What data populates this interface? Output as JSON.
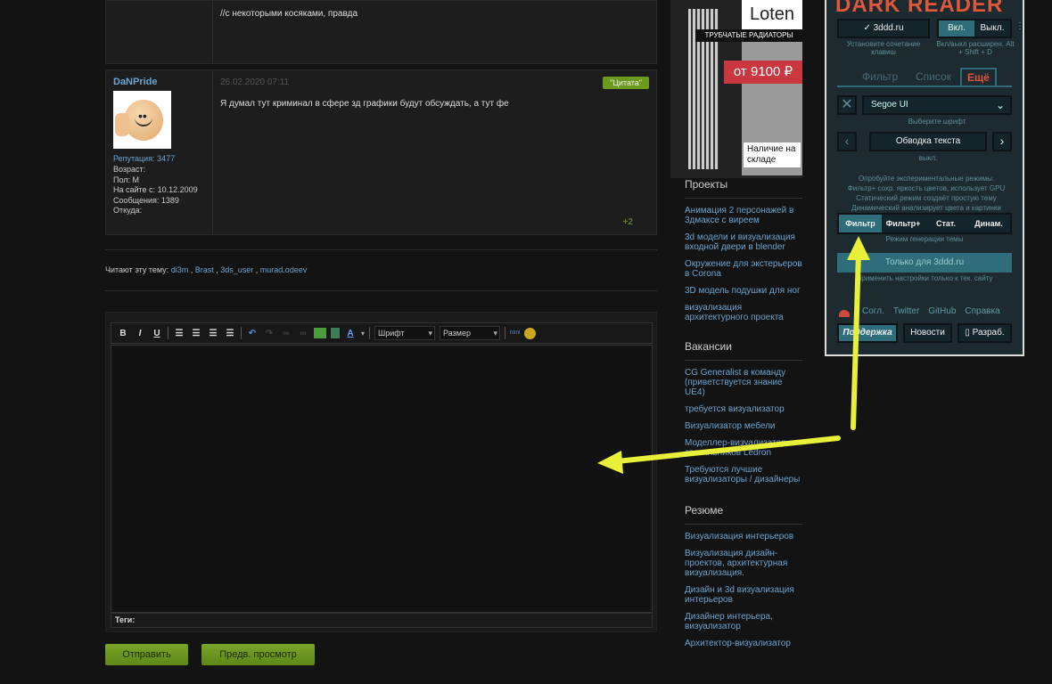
{
  "post1": {
    "text": "//с некоторыми косяками, правда"
  },
  "post2": {
    "author": "DaNPride",
    "date": "26.02.2020 07:11",
    "quote_label": "\"Цитата\"",
    "text": "Я думал тут криминал в сфере зд графики будут обсуждать, а тут фе",
    "reputation": "Репутация: 3477",
    "info": [
      "Возраст:",
      "Пол: М",
      "На сайте с: 10.12.2009",
      "Сообщения: 1389",
      "Откуда:"
    ],
    "rating": "+2"
  },
  "readers": {
    "label": "Читают эту тему:",
    "users": [
      "di3m",
      "Brast",
      "3ds_user",
      "murad.odeev"
    ]
  },
  "editor": {
    "font_select": "Шрифт",
    "size_select": "Размер",
    "html_label": "html",
    "tags_label": "Теги:",
    "submit": "Отправить",
    "preview": "Предв. просмотр"
  },
  "ad": {
    "brand": "Loten",
    "subtitle": "ТРУБЧАТЫЕ РАДИАТОРЫ",
    "price": "от 9100 ₽",
    "stock": "Наличие на складе"
  },
  "sidebar": {
    "sections": [
      {
        "title": "Проекты",
        "items": [
          "Анимация 2 персонажей в 3дмаксе с виреем",
          "3d модели и визуализация входной двери в blender",
          "Окружение для экстерьеров в Corona",
          "3D модель подушки для ног",
          "визуализация архитектурного проекта"
        ]
      },
      {
        "title": "Вакансии",
        "items": [
          "CG Generalist в команду (приветствуется знание UE4)",
          "требуется визуализатор",
          "Визуализатор мебели",
          "Моделлер-визуализатор светильников Ledron",
          "Требуются лучшие визуализаторы / дизайнеры"
        ]
      },
      {
        "title": "Резюме",
        "items": [
          "Визуализация интерьеров",
          "Визуализация дизайн-проектов, архитектурная визуализация.",
          "Дизайн и 3d визуализация интерьеров",
          "Дизайнер интерьера, визуализатор",
          "Архитектор-визуализатор"
        ]
      }
    ]
  },
  "darkreader": {
    "title": "DARK READER",
    "site": "✓ 3ddd.ru",
    "on": "Вкл.",
    "off": "Выкл.",
    "shortcut_hint": "Установите сочетание клавиш",
    "toggle_hint": "Вкл/выкл расширен. Alt + Shift + D",
    "tabs": [
      "Фильтр",
      "Список",
      "Ещё"
    ],
    "font": "Segoe UI",
    "font_hint": "Выберите шрифт",
    "stroke": "Обводка текста",
    "stroke_value": "выкл.",
    "experimental": [
      "Опробуйте экспериментальные режимы:",
      "Фильтр+ сохр. яркость цветов, использует GPU",
      "Статический режим создаёт простую тему",
      "Динамический анализирует цвета и картинки"
    ],
    "modes": [
      "Фильтр",
      "Фильтр+",
      "Стат.",
      "Динам."
    ],
    "mode_hint": "Режим генерации темы",
    "only_for": "Только для 3ddd.ru",
    "only_hint": "Применить настройки только к тек. сайту",
    "links": [
      "Согл.",
      "Twitter",
      "GitHub",
      "Справка"
    ],
    "support": "Поддержка",
    "news": "Новости",
    "dev": "▯ Разраб."
  },
  "colors": {
    "accent_green": "#6c9a1f",
    "link": "#6aa3cf",
    "darkreader_accent": "#e0573b",
    "arrow": "#e8f03a"
  }
}
